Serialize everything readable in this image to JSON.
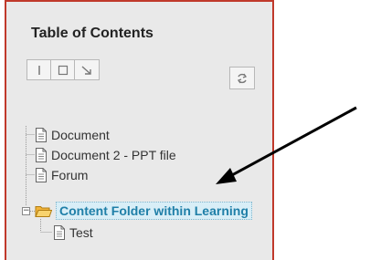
{
  "panel": {
    "title": "Table of Contents"
  },
  "toolbar": {
    "buttons": [
      {
        "icon": "expand-all-icon"
      },
      {
        "icon": "collapse-all-icon"
      },
      {
        "icon": "arrow-down-right-icon"
      }
    ],
    "refresh_icon": "refresh-icon"
  },
  "tree": {
    "items": [
      {
        "label": "Document",
        "icon": "document-icon"
      },
      {
        "label": "Document 2 - PPT file",
        "icon": "document-icon"
      },
      {
        "label": "Forum",
        "icon": "document-icon"
      },
      {
        "label": "Content Folder within Learning",
        "icon": "folder-icon",
        "expanded": true,
        "selected": true
      },
      {
        "label": "Test",
        "icon": "document-icon"
      }
    ]
  },
  "colors": {
    "panel_border": "#c0392b",
    "selected_text": "#1f7fa8",
    "selected_bg": "#d8eef7"
  }
}
